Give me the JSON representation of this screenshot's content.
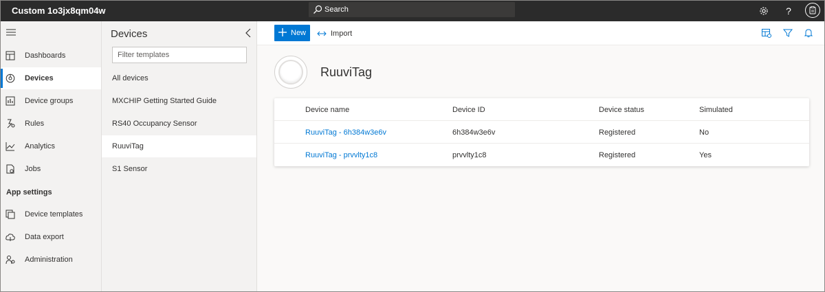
{
  "header": {
    "app_title": "Custom 1o3jx8qm04w",
    "search_placeholder": "Search",
    "icons": [
      "gear-icon",
      "help-icon",
      "account-icon"
    ]
  },
  "nav": {
    "items": [
      {
        "label": "Dashboards",
        "icon": "dashboard-icon"
      },
      {
        "label": "Devices",
        "icon": "devices-icon",
        "selected": true
      },
      {
        "label": "Device groups",
        "icon": "device-groups-icon"
      },
      {
        "label": "Rules",
        "icon": "rules-icon"
      },
      {
        "label": "Analytics",
        "icon": "analytics-icon"
      },
      {
        "label": "Jobs",
        "icon": "jobs-icon"
      }
    ],
    "section_label": "App settings",
    "settings_items": [
      {
        "label": "Device templates",
        "icon": "device-templates-icon"
      },
      {
        "label": "Data export",
        "icon": "data-export-icon"
      },
      {
        "label": "Administration",
        "icon": "administration-icon"
      }
    ]
  },
  "panel": {
    "title": "Devices",
    "filter_placeholder": "Filter templates",
    "templates": [
      {
        "label": "All devices"
      },
      {
        "label": "MXCHIP Getting Started Guide"
      },
      {
        "label": "RS40 Occupancy Sensor"
      },
      {
        "label": "RuuviTag",
        "selected": true
      },
      {
        "label": "S1 Sensor"
      }
    ]
  },
  "toolbar": {
    "new_label": "New",
    "import_label": "Import"
  },
  "device": {
    "title": "RuuviTag"
  },
  "table": {
    "columns": [
      "Device name",
      "Device ID",
      "Device status",
      "Simulated"
    ],
    "rows": [
      [
        "RuuviTag - 6h384w3e6v",
        "6h384w3e6v",
        "Registered",
        "No"
      ],
      [
        "RuuviTag - prvvlty1c8",
        "prvvlty1c8",
        "Registered",
        "Yes"
      ]
    ]
  },
  "colors": {
    "accent": "#0078d4",
    "topbar": "#2b2b2b",
    "nav_bg": "#f3f2f1"
  }
}
